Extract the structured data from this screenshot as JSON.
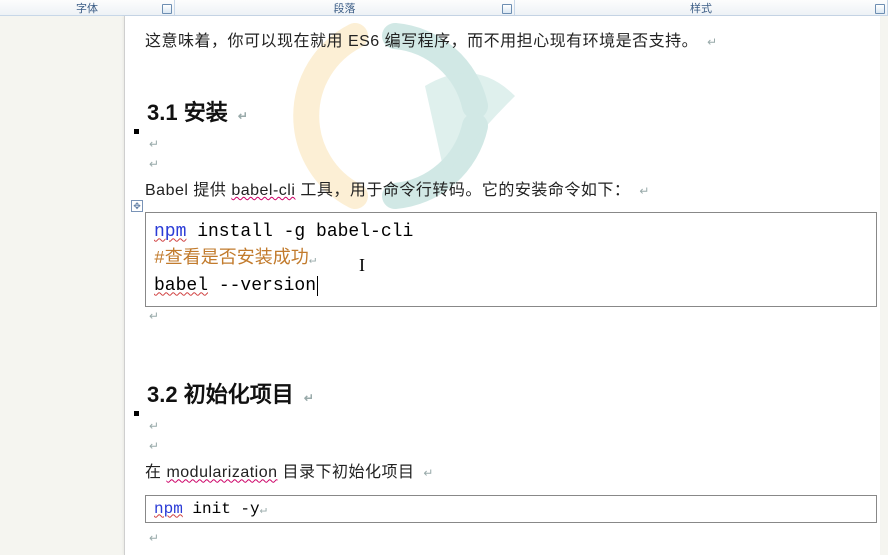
{
  "ribbon": {
    "font_label": "字体",
    "para_label": "段落",
    "style_label": "样式"
  },
  "content": {
    "line1": "这意味着，你可以现在就用 ES6 编写程序，而不用担心现有环境是否支持。",
    "h31": "3.1 安装",
    "para2_a": "Babel 提供 ",
    "para2_b": "babel-cli",
    "para2_c": " 工具，用于命令行转码。它的安装命令如下：",
    "h32": "3.2 初始化项目",
    "para3_a": "在 ",
    "para3_b": "modularization",
    "para3_c": " 目录下初始化项目"
  },
  "code1": {
    "l1_kw": "npm",
    "l1_rest": " install -g babel-cli",
    "l2": "#查看是否安装成功",
    "l3_a": "babel",
    "l3_b": " --version"
  },
  "code2": {
    "l1_kw": "npm",
    "l1_rest": " init -y"
  }
}
